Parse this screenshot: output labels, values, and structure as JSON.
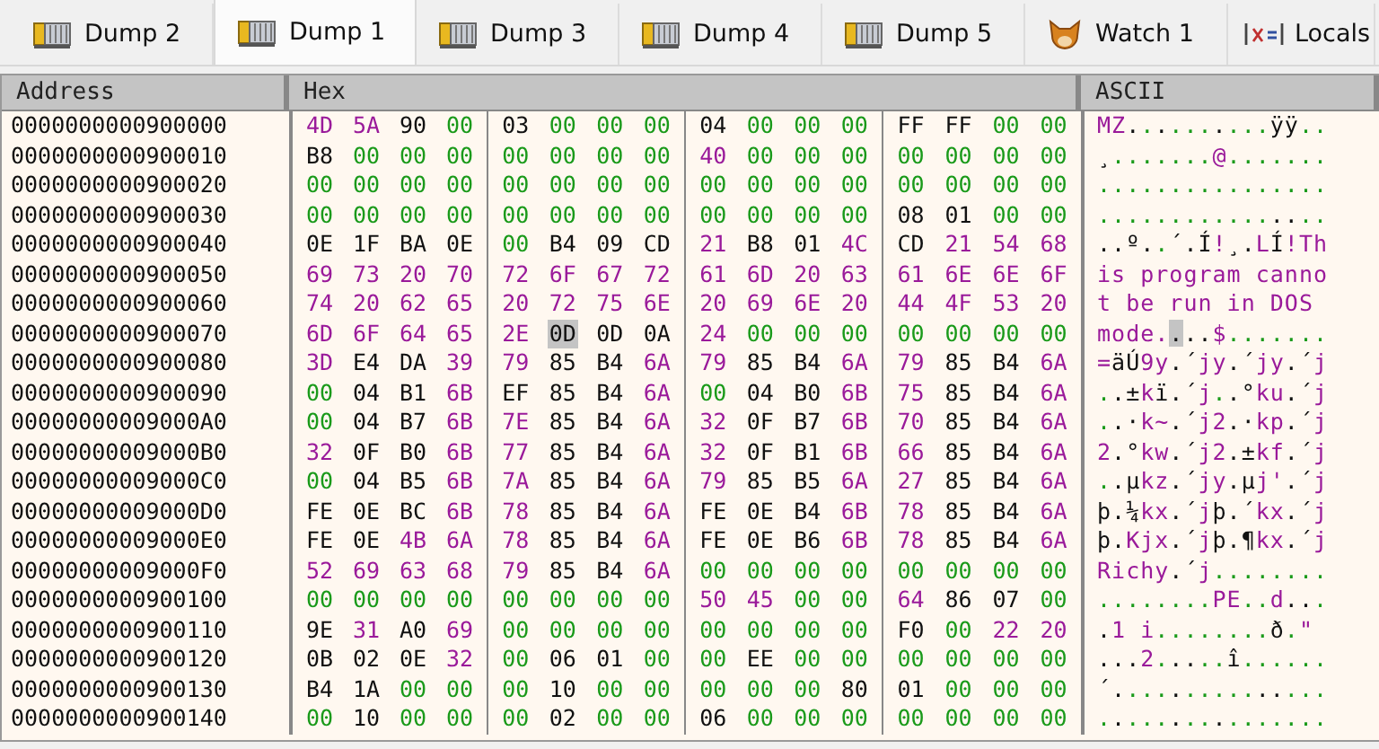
{
  "tabs": [
    {
      "label": "Dump 2",
      "kind": "dump",
      "selected": false
    },
    {
      "label": "Dump 1",
      "kind": "dump",
      "selected": true
    },
    {
      "label": "Dump 3",
      "kind": "dump",
      "selected": false
    },
    {
      "label": "Dump 4",
      "kind": "dump",
      "selected": false
    },
    {
      "label": "Dump 5",
      "kind": "dump",
      "selected": false
    },
    {
      "label": "Watch 1",
      "kind": "watch",
      "selected": false
    },
    {
      "label": "Locals",
      "kind": "locals",
      "selected": false
    }
  ],
  "columns": [
    "Address",
    "Hex",
    "ASCII"
  ],
  "rows": [
    {
      "address": "0000000000900000",
      "bytes": [
        {
          "hex": "4D",
          "selected": false
        },
        {
          "hex": "5A",
          "selected": false
        },
        {
          "hex": "90",
          "selected": false
        },
        {
          "hex": "00",
          "selected": false
        },
        {
          "hex": "03",
          "selected": false
        },
        {
          "hex": "00",
          "selected": false
        },
        {
          "hex": "00",
          "selected": false
        },
        {
          "hex": "00",
          "selected": false
        },
        {
          "hex": "04",
          "selected": false
        },
        {
          "hex": "00",
          "selected": false
        },
        {
          "hex": "00",
          "selected": false
        },
        {
          "hex": "00",
          "selected": false
        },
        {
          "hex": "FF",
          "selected": false
        },
        {
          "hex": "FF",
          "selected": false
        },
        {
          "hex": "00",
          "selected": false
        },
        {
          "hex": "00",
          "selected": false
        }
      ],
      "ascii": "MZ..........ÿÿ.."
    },
    {
      "address": "0000000000900010",
      "bytes": [
        {
          "hex": "B8",
          "selected": false
        },
        {
          "hex": "00",
          "selected": false
        },
        {
          "hex": "00",
          "selected": false
        },
        {
          "hex": "00",
          "selected": false
        },
        {
          "hex": "00",
          "selected": false
        },
        {
          "hex": "00",
          "selected": false
        },
        {
          "hex": "00",
          "selected": false
        },
        {
          "hex": "00",
          "selected": false
        },
        {
          "hex": "40",
          "selected": false
        },
        {
          "hex": "00",
          "selected": false
        },
        {
          "hex": "00",
          "selected": false
        },
        {
          "hex": "00",
          "selected": false
        },
        {
          "hex": "00",
          "selected": false
        },
        {
          "hex": "00",
          "selected": false
        },
        {
          "hex": "00",
          "selected": false
        },
        {
          "hex": "00",
          "selected": false
        }
      ],
      "ascii": "¸.......@......."
    },
    {
      "address": "0000000000900020",
      "bytes": [
        {
          "hex": "00",
          "selected": false
        },
        {
          "hex": "00",
          "selected": false
        },
        {
          "hex": "00",
          "selected": false
        },
        {
          "hex": "00",
          "selected": false
        },
        {
          "hex": "00",
          "selected": false
        },
        {
          "hex": "00",
          "selected": false
        },
        {
          "hex": "00",
          "selected": false
        },
        {
          "hex": "00",
          "selected": false
        },
        {
          "hex": "00",
          "selected": false
        },
        {
          "hex": "00",
          "selected": false
        },
        {
          "hex": "00",
          "selected": false
        },
        {
          "hex": "00",
          "selected": false
        },
        {
          "hex": "00",
          "selected": false
        },
        {
          "hex": "00",
          "selected": false
        },
        {
          "hex": "00",
          "selected": false
        },
        {
          "hex": "00",
          "selected": false
        }
      ],
      "ascii": "................"
    },
    {
      "address": "0000000000900030",
      "bytes": [
        {
          "hex": "00",
          "selected": false
        },
        {
          "hex": "00",
          "selected": false
        },
        {
          "hex": "00",
          "selected": false
        },
        {
          "hex": "00",
          "selected": false
        },
        {
          "hex": "00",
          "selected": false
        },
        {
          "hex": "00",
          "selected": false
        },
        {
          "hex": "00",
          "selected": false
        },
        {
          "hex": "00",
          "selected": false
        },
        {
          "hex": "00",
          "selected": false
        },
        {
          "hex": "00",
          "selected": false
        },
        {
          "hex": "00",
          "selected": false
        },
        {
          "hex": "00",
          "selected": false
        },
        {
          "hex": "08",
          "selected": false
        },
        {
          "hex": "01",
          "selected": false
        },
        {
          "hex": "00",
          "selected": false
        },
        {
          "hex": "00",
          "selected": false
        }
      ],
      "ascii": "................"
    },
    {
      "address": "0000000000900040",
      "bytes": [
        {
          "hex": "0E",
          "selected": false
        },
        {
          "hex": "1F",
          "selected": false
        },
        {
          "hex": "BA",
          "selected": false
        },
        {
          "hex": "0E",
          "selected": false
        },
        {
          "hex": "00",
          "selected": false
        },
        {
          "hex": "B4",
          "selected": false
        },
        {
          "hex": "09",
          "selected": false
        },
        {
          "hex": "CD",
          "selected": false
        },
        {
          "hex": "21",
          "selected": false
        },
        {
          "hex": "B8",
          "selected": false
        },
        {
          "hex": "01",
          "selected": false
        },
        {
          "hex": "4C",
          "selected": false
        },
        {
          "hex": "CD",
          "selected": false
        },
        {
          "hex": "21",
          "selected": false
        },
        {
          "hex": "54",
          "selected": false
        },
        {
          "hex": "68",
          "selected": false
        }
      ],
      "ascii": "..º..´.Í!¸.LÍ!Th"
    },
    {
      "address": "0000000000900050",
      "bytes": [
        {
          "hex": "69",
          "selected": false
        },
        {
          "hex": "73",
          "selected": false
        },
        {
          "hex": "20",
          "selected": false
        },
        {
          "hex": "70",
          "selected": false
        },
        {
          "hex": "72",
          "selected": false
        },
        {
          "hex": "6F",
          "selected": false
        },
        {
          "hex": "67",
          "selected": false
        },
        {
          "hex": "72",
          "selected": false
        },
        {
          "hex": "61",
          "selected": false
        },
        {
          "hex": "6D",
          "selected": false
        },
        {
          "hex": "20",
          "selected": false
        },
        {
          "hex": "63",
          "selected": false
        },
        {
          "hex": "61",
          "selected": false
        },
        {
          "hex": "6E",
          "selected": false
        },
        {
          "hex": "6E",
          "selected": false
        },
        {
          "hex": "6F",
          "selected": false
        }
      ],
      "ascii": "is program canno"
    },
    {
      "address": "0000000000900060",
      "bytes": [
        {
          "hex": "74",
          "selected": false
        },
        {
          "hex": "20",
          "selected": false
        },
        {
          "hex": "62",
          "selected": false
        },
        {
          "hex": "65",
          "selected": false
        },
        {
          "hex": "20",
          "selected": false
        },
        {
          "hex": "72",
          "selected": false
        },
        {
          "hex": "75",
          "selected": false
        },
        {
          "hex": "6E",
          "selected": false
        },
        {
          "hex": "20",
          "selected": false
        },
        {
          "hex": "69",
          "selected": false
        },
        {
          "hex": "6E",
          "selected": false
        },
        {
          "hex": "20",
          "selected": false
        },
        {
          "hex": "44",
          "selected": false
        },
        {
          "hex": "4F",
          "selected": false
        },
        {
          "hex": "53",
          "selected": false
        },
        {
          "hex": "20",
          "selected": false
        }
      ],
      "ascii": "t be run in DOS "
    },
    {
      "address": "0000000000900070",
      "bytes": [
        {
          "hex": "6D",
          "selected": false
        },
        {
          "hex": "6F",
          "selected": false
        },
        {
          "hex": "64",
          "selected": false
        },
        {
          "hex": "65",
          "selected": false
        },
        {
          "hex": "2E",
          "selected": false
        },
        {
          "hex": "0D",
          "selected": true
        },
        {
          "hex": "0D",
          "selected": false
        },
        {
          "hex": "0A",
          "selected": false
        },
        {
          "hex": "24",
          "selected": false
        },
        {
          "hex": "00",
          "selected": false
        },
        {
          "hex": "00",
          "selected": false
        },
        {
          "hex": "00",
          "selected": false
        },
        {
          "hex": "00",
          "selected": false
        },
        {
          "hex": "00",
          "selected": false
        },
        {
          "hex": "00",
          "selected": false
        },
        {
          "hex": "00",
          "selected": false
        }
      ],
      "ascii": "mode....$......."
    },
    {
      "address": "0000000000900080",
      "bytes": [
        {
          "hex": "3D",
          "selected": false
        },
        {
          "hex": "E4",
          "selected": false
        },
        {
          "hex": "DA",
          "selected": false
        },
        {
          "hex": "39",
          "selected": false
        },
        {
          "hex": "79",
          "selected": false
        },
        {
          "hex": "85",
          "selected": false
        },
        {
          "hex": "B4",
          "selected": false
        },
        {
          "hex": "6A",
          "selected": false
        },
        {
          "hex": "79",
          "selected": false
        },
        {
          "hex": "85",
          "selected": false
        },
        {
          "hex": "B4",
          "selected": false
        },
        {
          "hex": "6A",
          "selected": false
        },
        {
          "hex": "79",
          "selected": false
        },
        {
          "hex": "85",
          "selected": false
        },
        {
          "hex": "B4",
          "selected": false
        },
        {
          "hex": "6A",
          "selected": false
        }
      ],
      "ascii": "=äÚ9y.´jy.´jy.´j"
    },
    {
      "address": "0000000000900090",
      "bytes": [
        {
          "hex": "00",
          "selected": false
        },
        {
          "hex": "04",
          "selected": false
        },
        {
          "hex": "B1",
          "selected": false
        },
        {
          "hex": "6B",
          "selected": false
        },
        {
          "hex": "EF",
          "selected": false
        },
        {
          "hex": "85",
          "selected": false
        },
        {
          "hex": "B4",
          "selected": false
        },
        {
          "hex": "6A",
          "selected": false
        },
        {
          "hex": "00",
          "selected": false
        },
        {
          "hex": "04",
          "selected": false
        },
        {
          "hex": "B0",
          "selected": false
        },
        {
          "hex": "6B",
          "selected": false
        },
        {
          "hex": "75",
          "selected": false
        },
        {
          "hex": "85",
          "selected": false
        },
        {
          "hex": "B4",
          "selected": false
        },
        {
          "hex": "6A",
          "selected": false
        }
      ],
      "ascii": "..±kï.´j..°ku.´j"
    },
    {
      "address": "00000000009000A0",
      "bytes": [
        {
          "hex": "00",
          "selected": false
        },
        {
          "hex": "04",
          "selected": false
        },
        {
          "hex": "B7",
          "selected": false
        },
        {
          "hex": "6B",
          "selected": false
        },
        {
          "hex": "7E",
          "selected": false
        },
        {
          "hex": "85",
          "selected": false
        },
        {
          "hex": "B4",
          "selected": false
        },
        {
          "hex": "6A",
          "selected": false
        },
        {
          "hex": "32",
          "selected": false
        },
        {
          "hex": "0F",
          "selected": false
        },
        {
          "hex": "B7",
          "selected": false
        },
        {
          "hex": "6B",
          "selected": false
        },
        {
          "hex": "70",
          "selected": false
        },
        {
          "hex": "85",
          "selected": false
        },
        {
          "hex": "B4",
          "selected": false
        },
        {
          "hex": "6A",
          "selected": false
        }
      ],
      "ascii": "..·k~.´j2.·kp.´j"
    },
    {
      "address": "00000000009000B0",
      "bytes": [
        {
          "hex": "32",
          "selected": false
        },
        {
          "hex": "0F",
          "selected": false
        },
        {
          "hex": "B0",
          "selected": false
        },
        {
          "hex": "6B",
          "selected": false
        },
        {
          "hex": "77",
          "selected": false
        },
        {
          "hex": "85",
          "selected": false
        },
        {
          "hex": "B4",
          "selected": false
        },
        {
          "hex": "6A",
          "selected": false
        },
        {
          "hex": "32",
          "selected": false
        },
        {
          "hex": "0F",
          "selected": false
        },
        {
          "hex": "B1",
          "selected": false
        },
        {
          "hex": "6B",
          "selected": false
        },
        {
          "hex": "66",
          "selected": false
        },
        {
          "hex": "85",
          "selected": false
        },
        {
          "hex": "B4",
          "selected": false
        },
        {
          "hex": "6A",
          "selected": false
        }
      ],
      "ascii": "2.°kw.´j2.±kf.´j"
    },
    {
      "address": "00000000009000C0",
      "bytes": [
        {
          "hex": "00",
          "selected": false
        },
        {
          "hex": "04",
          "selected": false
        },
        {
          "hex": "B5",
          "selected": false
        },
        {
          "hex": "6B",
          "selected": false
        },
        {
          "hex": "7A",
          "selected": false
        },
        {
          "hex": "85",
          "selected": false
        },
        {
          "hex": "B4",
          "selected": false
        },
        {
          "hex": "6A",
          "selected": false
        },
        {
          "hex": "79",
          "selected": false
        },
        {
          "hex": "85",
          "selected": false
        },
        {
          "hex": "B5",
          "selected": false
        },
        {
          "hex": "6A",
          "selected": false
        },
        {
          "hex": "27",
          "selected": false
        },
        {
          "hex": "85",
          "selected": false
        },
        {
          "hex": "B4",
          "selected": false
        },
        {
          "hex": "6A",
          "selected": false
        }
      ],
      "ascii": "..µkz.´jy.µj'.´j"
    },
    {
      "address": "00000000009000D0",
      "bytes": [
        {
          "hex": "FE",
          "selected": false
        },
        {
          "hex": "0E",
          "selected": false
        },
        {
          "hex": "BC",
          "selected": false
        },
        {
          "hex": "6B",
          "selected": false
        },
        {
          "hex": "78",
          "selected": false
        },
        {
          "hex": "85",
          "selected": false
        },
        {
          "hex": "B4",
          "selected": false
        },
        {
          "hex": "6A",
          "selected": false
        },
        {
          "hex": "FE",
          "selected": false
        },
        {
          "hex": "0E",
          "selected": false
        },
        {
          "hex": "B4",
          "selected": false
        },
        {
          "hex": "6B",
          "selected": false
        },
        {
          "hex": "78",
          "selected": false
        },
        {
          "hex": "85",
          "selected": false
        },
        {
          "hex": "B4",
          "selected": false
        },
        {
          "hex": "6A",
          "selected": false
        }
      ],
      "ascii": "þ.¼kx.´jþ.´kx.´j"
    },
    {
      "address": "00000000009000E0",
      "bytes": [
        {
          "hex": "FE",
          "selected": false
        },
        {
          "hex": "0E",
          "selected": false
        },
        {
          "hex": "4B",
          "selected": false
        },
        {
          "hex": "6A",
          "selected": false
        },
        {
          "hex": "78",
          "selected": false
        },
        {
          "hex": "85",
          "selected": false
        },
        {
          "hex": "B4",
          "selected": false
        },
        {
          "hex": "6A",
          "selected": false
        },
        {
          "hex": "FE",
          "selected": false
        },
        {
          "hex": "0E",
          "selected": false
        },
        {
          "hex": "B6",
          "selected": false
        },
        {
          "hex": "6B",
          "selected": false
        },
        {
          "hex": "78",
          "selected": false
        },
        {
          "hex": "85",
          "selected": false
        },
        {
          "hex": "B4",
          "selected": false
        },
        {
          "hex": "6A",
          "selected": false
        }
      ],
      "ascii": "þ.Kjx.´jþ.¶kx.´j"
    },
    {
      "address": "00000000009000F0",
      "bytes": [
        {
          "hex": "52",
          "selected": false
        },
        {
          "hex": "69",
          "selected": false
        },
        {
          "hex": "63",
          "selected": false
        },
        {
          "hex": "68",
          "selected": false
        },
        {
          "hex": "79",
          "selected": false
        },
        {
          "hex": "85",
          "selected": false
        },
        {
          "hex": "B4",
          "selected": false
        },
        {
          "hex": "6A",
          "selected": false
        },
        {
          "hex": "00",
          "selected": false
        },
        {
          "hex": "00",
          "selected": false
        },
        {
          "hex": "00",
          "selected": false
        },
        {
          "hex": "00",
          "selected": false
        },
        {
          "hex": "00",
          "selected": false
        },
        {
          "hex": "00",
          "selected": false
        },
        {
          "hex": "00",
          "selected": false
        },
        {
          "hex": "00",
          "selected": false
        }
      ],
      "ascii": "Richy.´j........"
    },
    {
      "address": "0000000000900100",
      "bytes": [
        {
          "hex": "00",
          "selected": false
        },
        {
          "hex": "00",
          "selected": false
        },
        {
          "hex": "00",
          "selected": false
        },
        {
          "hex": "00",
          "selected": false
        },
        {
          "hex": "00",
          "selected": false
        },
        {
          "hex": "00",
          "selected": false
        },
        {
          "hex": "00",
          "selected": false
        },
        {
          "hex": "00",
          "selected": false
        },
        {
          "hex": "50",
          "selected": false
        },
        {
          "hex": "45",
          "selected": false
        },
        {
          "hex": "00",
          "selected": false
        },
        {
          "hex": "00",
          "selected": false
        },
        {
          "hex": "64",
          "selected": false
        },
        {
          "hex": "86",
          "selected": false
        },
        {
          "hex": "07",
          "selected": false
        },
        {
          "hex": "00",
          "selected": false
        }
      ],
      "ascii": "........PE..d..."
    },
    {
      "address": "0000000000900110",
      "bytes": [
        {
          "hex": "9E",
          "selected": false
        },
        {
          "hex": "31",
          "selected": false
        },
        {
          "hex": "A0",
          "selected": false
        },
        {
          "hex": "69",
          "selected": false
        },
        {
          "hex": "00",
          "selected": false
        },
        {
          "hex": "00",
          "selected": false
        },
        {
          "hex": "00",
          "selected": false
        },
        {
          "hex": "00",
          "selected": false
        },
        {
          "hex": "00",
          "selected": false
        },
        {
          "hex": "00",
          "selected": false
        },
        {
          "hex": "00",
          "selected": false
        },
        {
          "hex": "00",
          "selected": false
        },
        {
          "hex": "F0",
          "selected": false
        },
        {
          "hex": "00",
          "selected": false
        },
        {
          "hex": "22",
          "selected": false
        },
        {
          "hex": "20",
          "selected": false
        }
      ],
      "ascii": ".1 i........ð.\" "
    },
    {
      "address": "0000000000900120",
      "bytes": [
        {
          "hex": "0B",
          "selected": false
        },
        {
          "hex": "02",
          "selected": false
        },
        {
          "hex": "0E",
          "selected": false
        },
        {
          "hex": "32",
          "selected": false
        },
        {
          "hex": "00",
          "selected": false
        },
        {
          "hex": "06",
          "selected": false
        },
        {
          "hex": "01",
          "selected": false
        },
        {
          "hex": "00",
          "selected": false
        },
        {
          "hex": "00",
          "selected": false
        },
        {
          "hex": "EE",
          "selected": false
        },
        {
          "hex": "00",
          "selected": false
        },
        {
          "hex": "00",
          "selected": false
        },
        {
          "hex": "00",
          "selected": false
        },
        {
          "hex": "00",
          "selected": false
        },
        {
          "hex": "00",
          "selected": false
        },
        {
          "hex": "00",
          "selected": false
        }
      ],
      "ascii": "...2.....î......"
    },
    {
      "address": "0000000000900130",
      "bytes": [
        {
          "hex": "B4",
          "selected": false
        },
        {
          "hex": "1A",
          "selected": false
        },
        {
          "hex": "00",
          "selected": false
        },
        {
          "hex": "00",
          "selected": false
        },
        {
          "hex": "00",
          "selected": false
        },
        {
          "hex": "10",
          "selected": false
        },
        {
          "hex": "00",
          "selected": false
        },
        {
          "hex": "00",
          "selected": false
        },
        {
          "hex": "00",
          "selected": false
        },
        {
          "hex": "00",
          "selected": false
        },
        {
          "hex": "00",
          "selected": false
        },
        {
          "hex": "80",
          "selected": false
        },
        {
          "hex": "01",
          "selected": false
        },
        {
          "hex": "00",
          "selected": false
        },
        {
          "hex": "00",
          "selected": false
        },
        {
          "hex": "00",
          "selected": false
        }
      ],
      "ascii": "´..............."
    },
    {
      "address": "0000000000900140",
      "bytes": [
        {
          "hex": "00",
          "selected": false
        },
        {
          "hex": "10",
          "selected": false
        },
        {
          "hex": "00",
          "selected": false
        },
        {
          "hex": "00",
          "selected": false
        },
        {
          "hex": "00",
          "selected": false
        },
        {
          "hex": "02",
          "selected": false
        },
        {
          "hex": "00",
          "selected": false
        },
        {
          "hex": "00",
          "selected": false
        },
        {
          "hex": "06",
          "selected": false
        },
        {
          "hex": "00",
          "selected": false
        },
        {
          "hex": "00",
          "selected": false
        },
        {
          "hex": "00",
          "selected": false
        },
        {
          "hex": "00",
          "selected": false
        },
        {
          "hex": "00",
          "selected": false
        },
        {
          "hex": "00",
          "selected": false
        },
        {
          "hex": "00",
          "selected": false
        }
      ],
      "ascii": "................"
    }
  ]
}
